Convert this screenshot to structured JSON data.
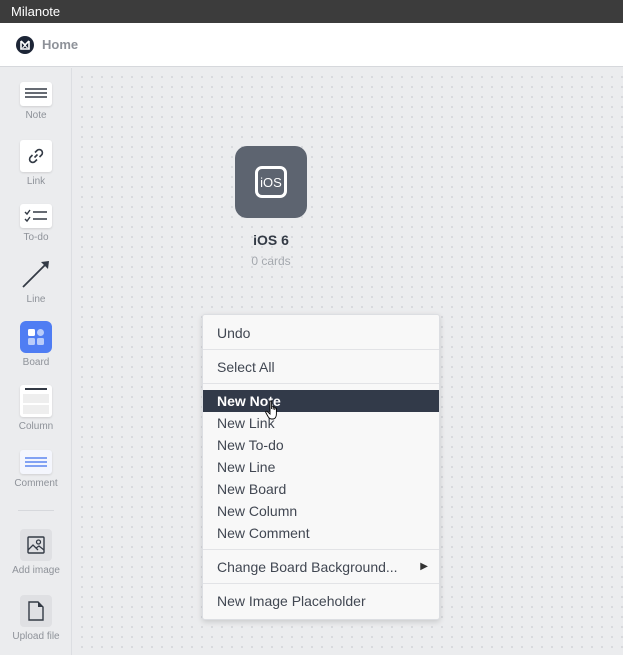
{
  "window": {
    "title": "Milanote"
  },
  "header": {
    "home_label": "Home",
    "logo_icon": "milanote-logo-icon"
  },
  "sidebar": {
    "tools": [
      {
        "label": "Note",
        "icon": "note-icon"
      },
      {
        "label": "Link",
        "icon": "link-icon"
      },
      {
        "label": "To-do",
        "icon": "todo-icon"
      },
      {
        "label": "Line",
        "icon": "line-arrow-icon"
      },
      {
        "label": "Board",
        "icon": "board-icon"
      },
      {
        "label": "Column",
        "icon": "column-icon"
      },
      {
        "label": "Comment",
        "icon": "comment-icon"
      },
      {
        "label": "Add image",
        "icon": "image-icon"
      },
      {
        "label": "Upload file",
        "icon": "file-icon"
      }
    ]
  },
  "canvas": {
    "board": {
      "icon_text": "iOS",
      "title": "iOS 6",
      "count": "0 cards"
    }
  },
  "context_menu": {
    "items": [
      {
        "label": "Undo"
      },
      {
        "label": "Select All"
      },
      {
        "label": "New Note",
        "selected": true
      },
      {
        "label": "New Link"
      },
      {
        "label": "New To-do"
      },
      {
        "label": "New Line"
      },
      {
        "label": "New Board"
      },
      {
        "label": "New Column"
      },
      {
        "label": "New Comment"
      },
      {
        "label": "Change Board Background...",
        "submenu": "▶"
      },
      {
        "label": "New Image Placeholder"
      }
    ]
  },
  "colors": {
    "accent": "#4f7df3",
    "selected_menu_bg": "#323a49",
    "titlebar": "#3c3c3c"
  }
}
